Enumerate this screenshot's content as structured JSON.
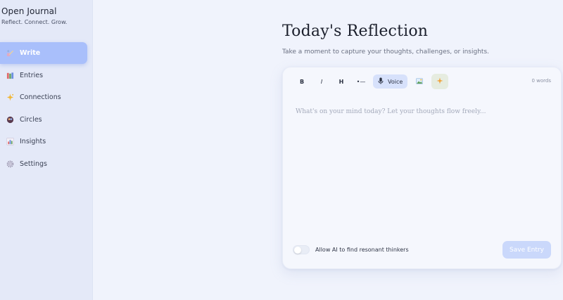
{
  "brand": {
    "title": "Open Journal",
    "tagline": "Reflect. Connect. Grow."
  },
  "sidebar": {
    "items": [
      {
        "label": "Write",
        "icon": "pencil-palette-icon",
        "glyph": "✏",
        "active": true
      },
      {
        "label": "Entries",
        "icon": "books-icon",
        "glyph": "📚",
        "active": false
      },
      {
        "label": "Connections",
        "icon": "sparkles-icon",
        "glyph": "✨",
        "active": false
      },
      {
        "label": "Circles",
        "icon": "circle-people-icon",
        "glyph": "●",
        "active": false
      },
      {
        "label": "Insights",
        "icon": "bar-chart-icon",
        "glyph": "▮",
        "active": false
      },
      {
        "label": "Settings",
        "icon": "gear-icon",
        "glyph": "⚙",
        "active": false
      }
    ]
  },
  "main": {
    "title": "Today's Reflection",
    "subtitle": "Take a moment to capture your thoughts, challenges, or insights."
  },
  "editor": {
    "toolbar": {
      "bold": "B",
      "italic": "I",
      "heading": "H",
      "list": "•—",
      "voice": "Voice",
      "image_icon": "image-icon",
      "ai_icon": "sparkle-icon"
    },
    "word_count": "0 words",
    "placeholder": "What's on your mind today? Let your thoughts flow freely...",
    "ai_toggle_label": "Allow AI to find resonant thinkers",
    "ai_toggle_on": false,
    "save_label": "Save Entry"
  },
  "colors": {
    "accent": "#a9bffb",
    "sidebar_bg": "#e4e9f8",
    "main_bg": "#f0f3fc",
    "save_disabled": "#cad8fb"
  }
}
